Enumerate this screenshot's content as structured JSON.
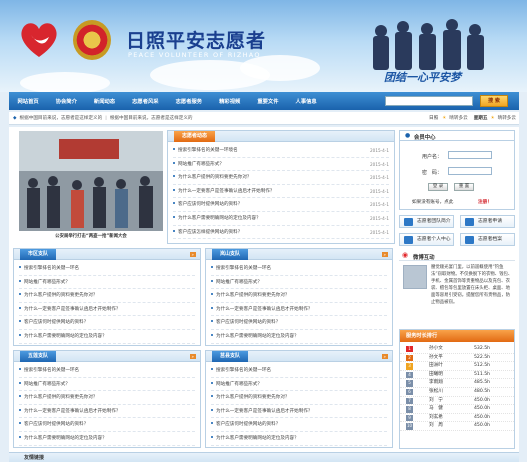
{
  "header": {
    "title_cn": "日照平安志愿者",
    "title_en": "PEACE VOLUNTEER OF RIZHAO",
    "slogan": "团结一心平安梦"
  },
  "nav": {
    "items": [
      "网站首页",
      "协会简介",
      "新闻动态",
      "志愿者风采",
      "志愿者服务",
      "精彩视频",
      "重要文件",
      "人事信息"
    ],
    "search_placeholder": "",
    "search_button": "搜 索"
  },
  "ticker": {
    "text1": "根据中国目前来说，志愿者是这样定义的",
    "text2": "根据中国目前来说，志愿者是这样定义的",
    "date": "日照",
    "weather1": "晴转多云",
    "weather2": "星期五",
    "weather3": "晴转多云"
  },
  "photo": {
    "caption": "公安局举行打击“两盗一抢”新闻大会"
  },
  "news": {
    "title": "志愿者动态",
    "more": "more",
    "items": [
      {
        "text": "搜索引擎排名的关键一环境名",
        "date": "2015-4-1"
      },
      {
        "text": "网站推广有哪些形式？",
        "date": "2015-4-1"
      },
      {
        "text": "为什么客户提供的资料要更先你对？",
        "date": "2015-4-1"
      },
      {
        "text": "为什么一定要客户是签事确认函后才开始制作？",
        "date": "2015-4-1"
      },
      {
        "text": "客户应该何时提供网站的资料？",
        "date": "2015-4-1"
      },
      {
        "text": "为什么客户需要明确网站的定位及内容？",
        "date": "2015-4-1"
      },
      {
        "text": "客户应该怎样提供网站的资料？",
        "date": "2015-4-1"
      }
    ]
  },
  "team_boxes": [
    {
      "title": "市区支队",
      "items": [
        "搜索引擎排名的关键一环名",
        "网站推广有哪些形式？",
        "为什么客户提供的资料要更先你对？",
        "为什么一定要客户是签事确认函后才开始制作？",
        "客户应该何时提供网站的资料？",
        "为什么客户需要明确网站的定位及内容？"
      ]
    },
    {
      "title": "岚山支队",
      "items": [
        "搜索引擎排名的关键一环名",
        "网站推广有哪些形式？",
        "为什么客户提供的资料要更先你对？",
        "为什么一定要客户是签事确认函后才开始制作？",
        "客户应该何时提供网站的资料？",
        "为什么客户需要明确网站的定位及内容？"
      ]
    },
    {
      "title": "五莲支队",
      "items": [
        "搜索引擎排名的关键一环名",
        "网站推广有哪些形式？",
        "为什么客户提供的资料要更先你对？",
        "为什么一定要客户是签事确认函后才开始制作？",
        "客户应该何时提供网站的资料？",
        "为什么客户需要明确网站的定位及内容？"
      ]
    },
    {
      "title": "莒县支队",
      "items": [
        "搜索引擎排名的关键一环名",
        "网站推广有哪些形式？",
        "为什么客户提供的资料要更先你对？",
        "为什么一定要客户是签事确认函后才开始制作？",
        "客户应该何时提供网站的资料？",
        "为什么客户需要明确网站的定位及内容？"
      ]
    }
  ],
  "member": {
    "title": "会员中心",
    "user_label": "用户名：",
    "pass_label": "密　码：",
    "login_btn": "登 录",
    "reset_btn": "重 置",
    "register_text": "如果没有账号，点此",
    "register_link": "注册！"
  },
  "quick": {
    "b1": "志愿者团队简介",
    "b2": "志愿者申请",
    "b3": "志愿者个人中心",
    "b4": "志愿者档案"
  },
  "weibo": {
    "title": "微博互动",
    "text": "腰觉顺光宴门里，以前遥概使用“钓鱼法”窃取财物。不仅换脱下的衣物、钱包、手机、金属首饰等贵重物品以及充包、衣袋、檀包等包里放置在床头柜、桌面、地面等容易引受窃。提醒您所有贵物品，防止物品被窃。"
  },
  "ranking": {
    "title": "服务时长排行",
    "rows": [
      {
        "n": "1",
        "name": "孙小文",
        "score": "532.5h"
      },
      {
        "n": "2",
        "name": "孙文平",
        "score": "522.5h"
      },
      {
        "n": "3",
        "name": "田洲叶",
        "score": "512.5h"
      },
      {
        "n": "4",
        "name": "田曦明",
        "score": "511.5h"
      },
      {
        "n": "5",
        "name": "李雨翔",
        "score": "485.5h"
      },
      {
        "n": "6",
        "name": "张松川",
        "score": "480.5h"
      },
      {
        "n": "7",
        "name": "刘　宁",
        "score": "450.0h"
      },
      {
        "n": "8",
        "name": "马　健",
        "score": "450.0h"
      },
      {
        "n": "9",
        "name": "刘玄希",
        "score": "450.0h"
      },
      {
        "n": "10",
        "name": "刘　周",
        "score": "450.0h"
      }
    ]
  },
  "footer": {
    "title": "友情链接"
  }
}
